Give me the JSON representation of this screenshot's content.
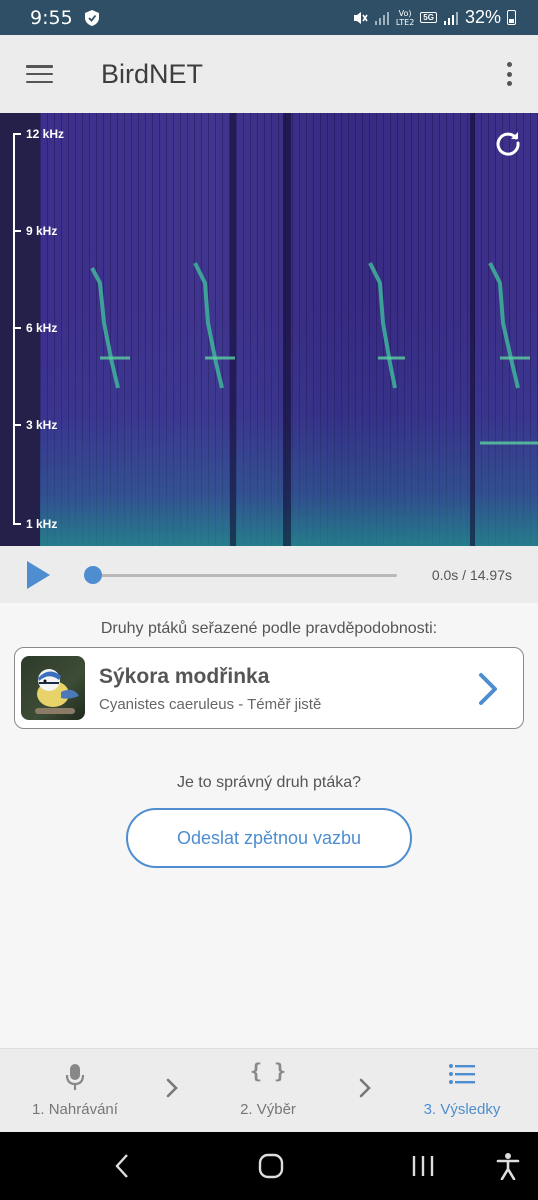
{
  "status_bar": {
    "time": "9:55",
    "volte": "Vo)",
    "lte": "LTE2",
    "network": "5G",
    "battery": "32%"
  },
  "app_bar": {
    "title": "BirdNET"
  },
  "spectrogram": {
    "axis_labels": [
      "12 kHz",
      "9 kHz",
      "6 kHz",
      "3 kHz",
      "1 kHz"
    ]
  },
  "player": {
    "time": "0.0s / 14.97s",
    "progress": 0
  },
  "results": {
    "heading": "Druhy ptáků seřazené podle pravděpodobnosti:",
    "items": [
      {
        "name": "Sýkora modřinka",
        "subtitle": "Cyanistes caeruleus - Téměř jistě"
      }
    ]
  },
  "feedback": {
    "question": "Je to správný druh ptáka?",
    "button_label": "Odeslat zpětnou vazbu"
  },
  "tabs": [
    {
      "label": "1. Nahrávání",
      "icon": "microphone-icon",
      "active": false
    },
    {
      "label": "2. Výběr",
      "icon": "braces-icon",
      "active": false
    },
    {
      "label": "3. Výsledky",
      "icon": "list-icon",
      "active": true
    }
  ],
  "colors": {
    "accent": "#4e8ed0",
    "status_bar": "#2f4f66",
    "spectrogram_bg": "#3b2a86"
  }
}
